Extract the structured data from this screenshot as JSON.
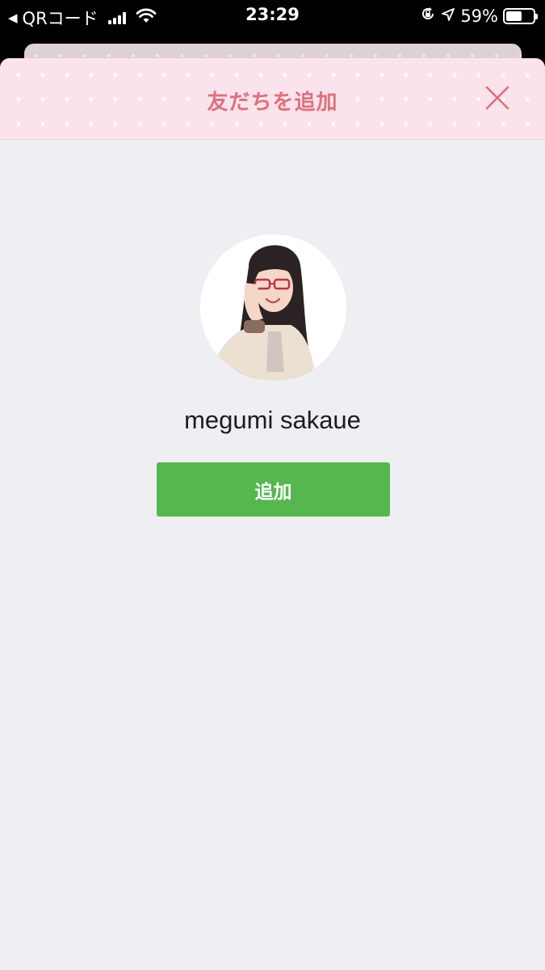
{
  "status_bar": {
    "back_arrow": "◀",
    "back_app": "QRコード",
    "time": "23:29",
    "battery_percent": "59%",
    "battery_level": 0.59,
    "icons": [
      "signal-icon",
      "wifi-icon",
      "orientation-lock-icon",
      "location-icon",
      "battery-icon"
    ]
  },
  "header": {
    "title": "友だちを追加",
    "close_icon": "close-icon"
  },
  "profile": {
    "name": "megumi sakaue",
    "add_button_label": "追加"
  },
  "colors": {
    "header_bg": "#fbe3ec",
    "title_color": "#e0707c",
    "body_bg": "#efeef3",
    "button_bg": "#56b74f"
  }
}
